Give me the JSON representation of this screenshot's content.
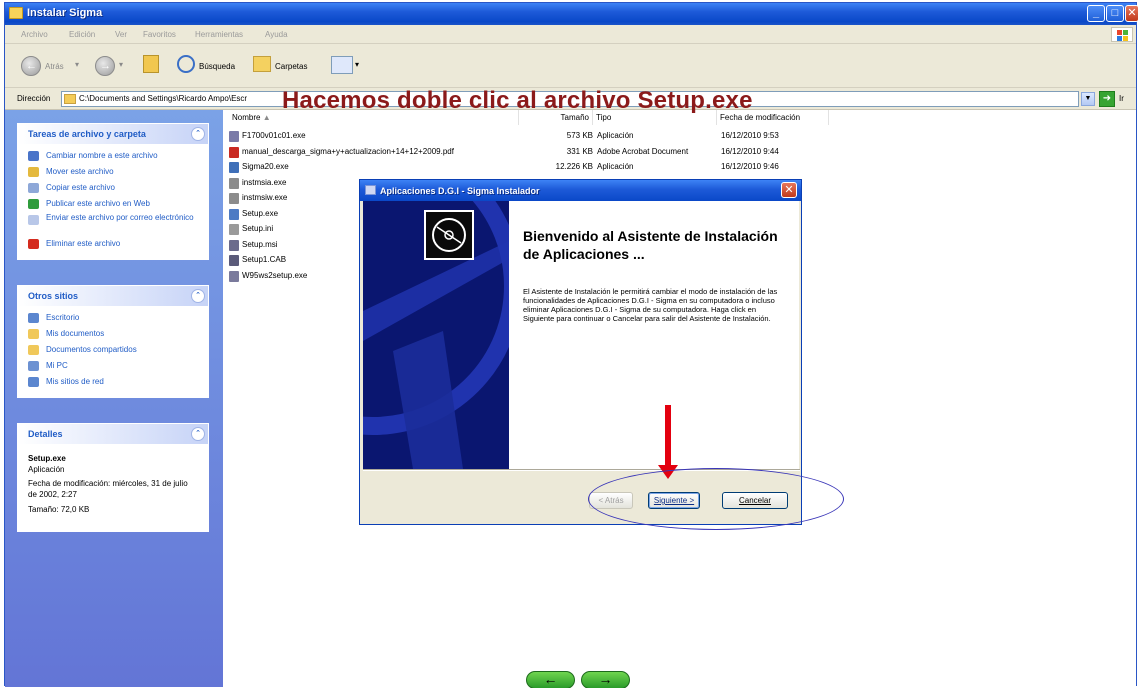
{
  "window": {
    "title": "Instalar Sigma",
    "min_glyph": "_",
    "max_glyph": "□",
    "close_glyph": "✕"
  },
  "menu": {
    "items": [
      "Archivo",
      "Edición",
      "Ver",
      "Favoritos",
      "Herramientas",
      "Ayuda"
    ]
  },
  "toolbar": {
    "back_label": "Atrás",
    "search_label": "Búsqueda",
    "folders_label": "Carpetas"
  },
  "address": {
    "label": "Dirección",
    "path": "C:\\Documents and Settings\\Ricardo Ampo\\Escr",
    "go_label": "Ir"
  },
  "caption": "Hacemos doble clic al archivo Setup.exe",
  "sidebar": {
    "tasks_title": "Tareas de archivo y carpeta",
    "tasks": [
      {
        "label": "Cambiar nombre a este archivo",
        "color": "#4a74c9"
      },
      {
        "label": "Mover este archivo",
        "color": "#e4b93e"
      },
      {
        "label": "Copiar este archivo",
        "color": "#8ea8d8"
      },
      {
        "label": "Publicar este archivo en Web",
        "color": "#2f9c3c"
      },
      {
        "label": "Enviar este archivo por correo electrónico",
        "color": "#b8c7e8"
      },
      {
        "label": "Eliminar este archivo",
        "color": "#d42b1e"
      }
    ],
    "places_title": "Otros sitios",
    "places": [
      {
        "label": "Escritorio",
        "color": "#5b86cf"
      },
      {
        "label": "Mis documentos",
        "color": "#f0c85a"
      },
      {
        "label": "Documentos compartidos",
        "color": "#f0c85a"
      },
      {
        "label": "Mi PC",
        "color": "#6c91d2"
      },
      {
        "label": "Mis sitios de red",
        "color": "#5b86cf"
      }
    ],
    "details_title": "Detalles",
    "details": {
      "name": "Setup.exe",
      "type": "Aplicación",
      "modified": "Fecha de modificación: miércoles, 31 de julio de 2002, 2:27",
      "size": "Tamaño: 72,0 KB"
    }
  },
  "filelist": {
    "headers": {
      "name": "Nombre",
      "size": "Tamaño",
      "type": "Tipo",
      "modified": "Fecha de modificación"
    },
    "files": [
      {
        "name": "F1700v01c01.exe",
        "size": "573 KB",
        "type": "Aplicación",
        "date": "16/12/2010 9:53",
        "color": "#7a7aa8"
      },
      {
        "name": "manual_descarga_sigma+y+actualizacion+14+12+2009.pdf",
        "size": "331 KB",
        "type": "Adobe Acrobat Document",
        "date": "16/12/2010 9:44",
        "color": "#c92a22"
      },
      {
        "name": "Sigma20.exe",
        "size": "12.226 KB",
        "type": "Aplicación",
        "date": "16/12/2010 9:46",
        "color": "#3f6fb8"
      },
      {
        "name": "instmsia.exe",
        "size": "",
        "type": "",
        "date": "",
        "color": "#8c8c8c"
      },
      {
        "name": "instmsiw.exe",
        "size": "",
        "type": "",
        "date": "",
        "color": "#8c8c8c"
      },
      {
        "name": "Setup.exe",
        "size": "",
        "type": "",
        "date": "",
        "color": "#4d7bc4"
      },
      {
        "name": "Setup.ini",
        "size": "",
        "type": "",
        "date": "",
        "color": "#9a9a9a"
      },
      {
        "name": "Setup.msi",
        "size": "",
        "type": "",
        "date": "",
        "color": "#6b6b8c"
      },
      {
        "name": "Setup1.CAB",
        "size": "",
        "type": "",
        "date": "",
        "color": "#5b5b7a"
      },
      {
        "name": "W95ws2setup.exe",
        "size": "",
        "type": "",
        "date": "",
        "color": "#7a7a9c"
      }
    ]
  },
  "dialog": {
    "title": "Aplicaciones D.G.I - Sigma Instalador",
    "heading": "Bienvenido al Asistente de Instalación de Aplicaciones ...",
    "body": "El Asistente de Instalación le permitirá cambiar el modo de instalación de las funcionalidades de Aplicaciones D.G.I - Sigma en su computadora o incluso eliminar Aplicaciones D.G.I - Sigma de su computadora.  Haga click en Siguiente para continuar o Cancelar para salir del Asistente de Instalación.",
    "back_label": "< Atrás",
    "next_label": "Siguiente >",
    "cancel_label": "Cancelar"
  },
  "nav": {
    "prev_glyph": "←",
    "next_glyph": "→"
  }
}
